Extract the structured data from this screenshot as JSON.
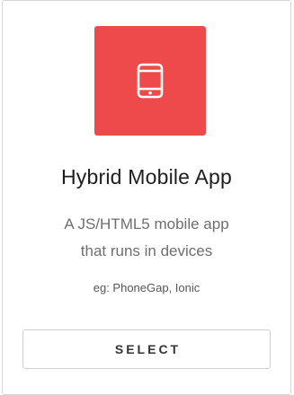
{
  "card": {
    "icon": "mobile-phone-icon",
    "accent_color": "#ee4a4c",
    "title": "Hybrid Mobile App",
    "description_lines": [
      "A JS/HTML5 mobile app",
      "that runs in devices"
    ],
    "example": "eg: PhoneGap, Ionic",
    "button_label": "SELECT"
  }
}
